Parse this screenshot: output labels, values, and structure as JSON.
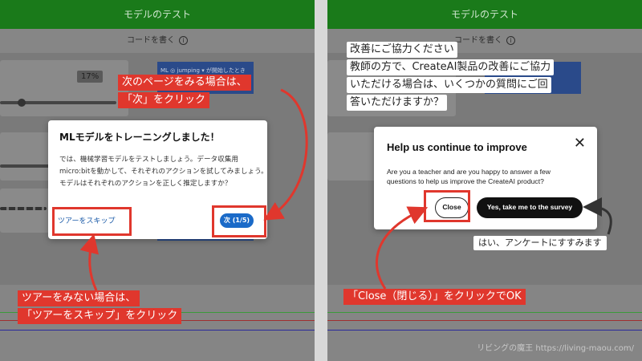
{
  "left": {
    "topbar_title": "モデルのテスト",
    "subbar_label": "コードを書く",
    "info_icon": "i",
    "percent_badge": "17%",
    "code_block_text": "ML ◎ jumping ▾ が開始したとき",
    "dialog": {
      "title": "MLモデルをトレーニングしました！",
      "body": "では、機械学習モデルをテストしましょう。データ収集用micro:bitを動かして、それぞれのアクションを試してみましょう。モデルはそれぞれのアクションを正しく推定しますか？",
      "skip_link": "ツアーをスキップ",
      "next_button": "次 (1/5)"
    },
    "callout_next": [
      "次のページをみる場合は、",
      "「次」をクリック"
    ],
    "callout_skip": [
      "ツアーをみない場合は、",
      "「ツアーをスキップ」をクリック"
    ]
  },
  "right": {
    "topbar_title": "モデルのテスト",
    "subbar_label": "コードを書く",
    "info_icon": "i",
    "dialog": {
      "title": "Help us continue to improve",
      "close_x": "✕",
      "body": "Are you a teacher and are you happy to answer a few questions to help us improve the CreateAI product?",
      "close_button": "Close",
      "yes_button": "Yes, take me to the survey"
    },
    "note_top": [
      "改善にご協力ください",
      "教師の方で、CreateAI製品の改善にご協力",
      "いただける場合は、いくつかの質問にご回",
      "答いただけますか？"
    ],
    "note_yes": "はい、アンケートにすすみます",
    "callout_close": "「Close（閉じる）」をクリックでOK",
    "watermark": "リビングの魔王 https://living-maou.com/"
  },
  "colors": {
    "accent_red": "#e0372d",
    "topbar_green": "#1a7a1a",
    "button_blue": "#1a6ac8"
  }
}
